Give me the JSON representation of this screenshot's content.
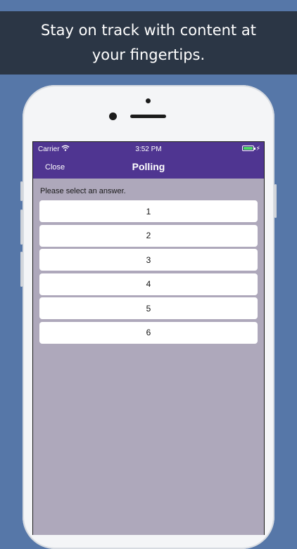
{
  "banner": {
    "line1": "Stay on track with content at",
    "line2": "your fingertips."
  },
  "status_bar": {
    "carrier": "Carrier",
    "time": "3:52 PM",
    "battery_charging": true
  },
  "nav": {
    "close_label": "Close",
    "title": "Polling"
  },
  "poll": {
    "prompt": "Please select an answer.",
    "options": [
      {
        "label": "1"
      },
      {
        "label": "2"
      },
      {
        "label": "3"
      },
      {
        "label": "4"
      },
      {
        "label": "5"
      },
      {
        "label": "6"
      }
    ]
  },
  "colors": {
    "background": "#5677a8",
    "banner": "#2b3645",
    "nav_accent": "#4f3591",
    "screen_background": "#aea8bb",
    "battery": "#4cd964"
  }
}
